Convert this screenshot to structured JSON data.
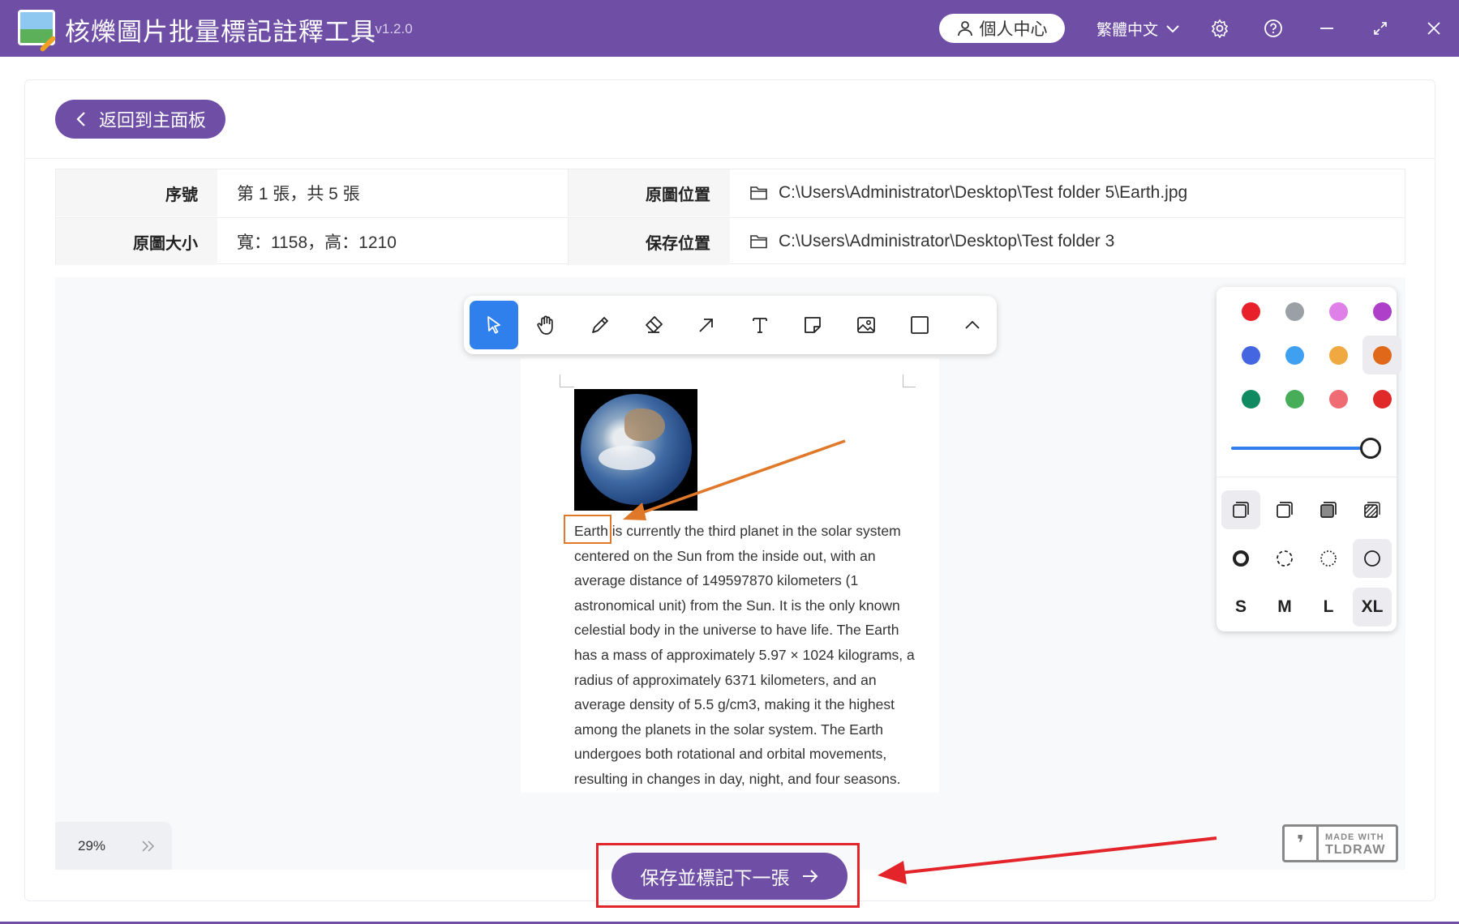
{
  "app": {
    "title": "核爍圖片批量標記註釋工具",
    "version": "- v1.2.0",
    "user_center": "個人中心",
    "language": "繁體中文"
  },
  "nav": {
    "back_label": "返回到主面板"
  },
  "info": {
    "index_label": "序號",
    "index_value": "第 1 張，共 5 張",
    "source_label": "原圖位置",
    "source_path": "C:\\Users\\Administrator\\Desktop\\Test folder 5\\Earth.jpg",
    "size_label": "原圖大小",
    "size_value": "寬：1158，高：1210",
    "save_label": "保存位置",
    "save_path": "C:\\Users\\Administrator\\Desktop\\Test folder 3"
  },
  "toolbar": {
    "tools": [
      "select-icon",
      "hand-icon",
      "pencil-icon",
      "eraser-icon",
      "arrow-icon",
      "text-icon",
      "note-icon",
      "image-icon",
      "rectangle-icon",
      "chevron-up-icon"
    ],
    "active_tool": "select"
  },
  "document": {
    "lines": [
      "Earth is currently the third planet in the solar system",
      "centered on the Sun from the inside out, with an",
      "average distance of 149597870 kilometers (1",
      "astronomical unit) from the Sun. It is the only known",
      "celestial body in the universe to have life. The Earth",
      "has a mass of approximately 5.97 × 1024 kilograms, a",
      "radius of approximately 6371 kilometers, and an",
      "average density of 5.5 g/cm3, making it the highest",
      "among the planets in the solar system. The Earth",
      "undergoes both rotational and orbital movements,",
      "resulting in changes in day, night, and four seasons."
    ]
  },
  "style_panel": {
    "colors": [
      "#e8202a",
      "#9aa0a6",
      "#df7fe8",
      "#ad3fc8",
      "#4466e0",
      "#3f9ff0",
      "#f0a840",
      "#e0681a",
      "#108a60",
      "#48ad58",
      "#f06c74",
      "#e02a2a"
    ],
    "selected_color": "#e0681a",
    "opacity_percent": 100,
    "fill_options": [
      "fill-none-icon",
      "fill-semi-icon",
      "fill-solid-icon",
      "fill-pattern-icon"
    ],
    "selected_fill": "fill-none-icon",
    "dash_options": [
      "dash-draw-icon",
      "dash-dashed-icon",
      "dash-dotted-icon",
      "dash-solid-icon"
    ],
    "selected_dash": "dash-solid-icon",
    "sizes": [
      "S",
      "M",
      "L",
      "XL"
    ],
    "selected_size": "XL"
  },
  "zoom": {
    "level": "29%"
  },
  "branding": {
    "made_with": "MADE WITH",
    "tldraw": "TLDRAW"
  },
  "actions": {
    "save_next": "保存並標記下一張"
  },
  "colors": {
    "brand": "#6f4ea6",
    "accent": "#2f80ed",
    "annotation": "#e0782a",
    "callout": "#e3252b"
  }
}
